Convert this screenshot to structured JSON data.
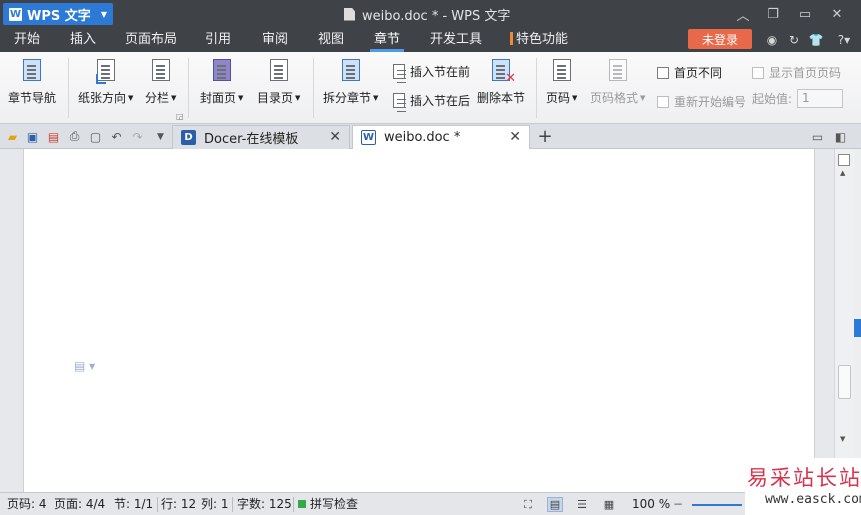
{
  "titlebar": {
    "app_label": "WPS 文字",
    "app_logo": "W",
    "window_title": "weibo.doc * - WPS 文字",
    "bg_color": "#3f4247",
    "accent_color": "#2d7ad6"
  },
  "menu": {
    "tabs": [
      {
        "label": "开始"
      },
      {
        "label": "插入"
      },
      {
        "label": "页面布局"
      },
      {
        "label": "引用"
      },
      {
        "label": "审阅"
      },
      {
        "label": "视图"
      },
      {
        "label": "章节",
        "active": true
      },
      {
        "label": "开发工具"
      },
      {
        "label": "特色功能"
      }
    ],
    "login_label": "未登录",
    "login_color": "#e8684a"
  },
  "ribbon": {
    "section_nav": "章节导航",
    "orientation": "纸张方向",
    "columns": "分栏",
    "cover_page": "封面页",
    "toc_page": "目录页",
    "split_section": "拆分章节",
    "insert_before": "插入节在前",
    "insert_after": "插入节在后",
    "delete_section": "删除本节",
    "page_number": "页码",
    "page_number_format": "页码格式",
    "first_page_diff": "首页不同",
    "restart_numbering": "重新开始编号",
    "show_first_page_number": "显示首页页码",
    "start_value_label": "起始值:",
    "start_value": "1"
  },
  "doc_tabs": [
    {
      "label": "Docer-在线模板",
      "icon": "docer-icon",
      "active": false
    },
    {
      "label": "weibo.doc *",
      "icon": "word-doc-icon",
      "active": true
    }
  ],
  "statusbar": {
    "page_num": "页码: 4",
    "pages": "页面: 4/4",
    "section": "节: 1/1",
    "line": "行: 12",
    "column": "列: 1",
    "word_count": "字数: 125",
    "spell_check": "拼写检查",
    "zoom": "100 %"
  },
  "watermark": {
    "cn": "易采站长站",
    "url": "www.easck.com"
  }
}
